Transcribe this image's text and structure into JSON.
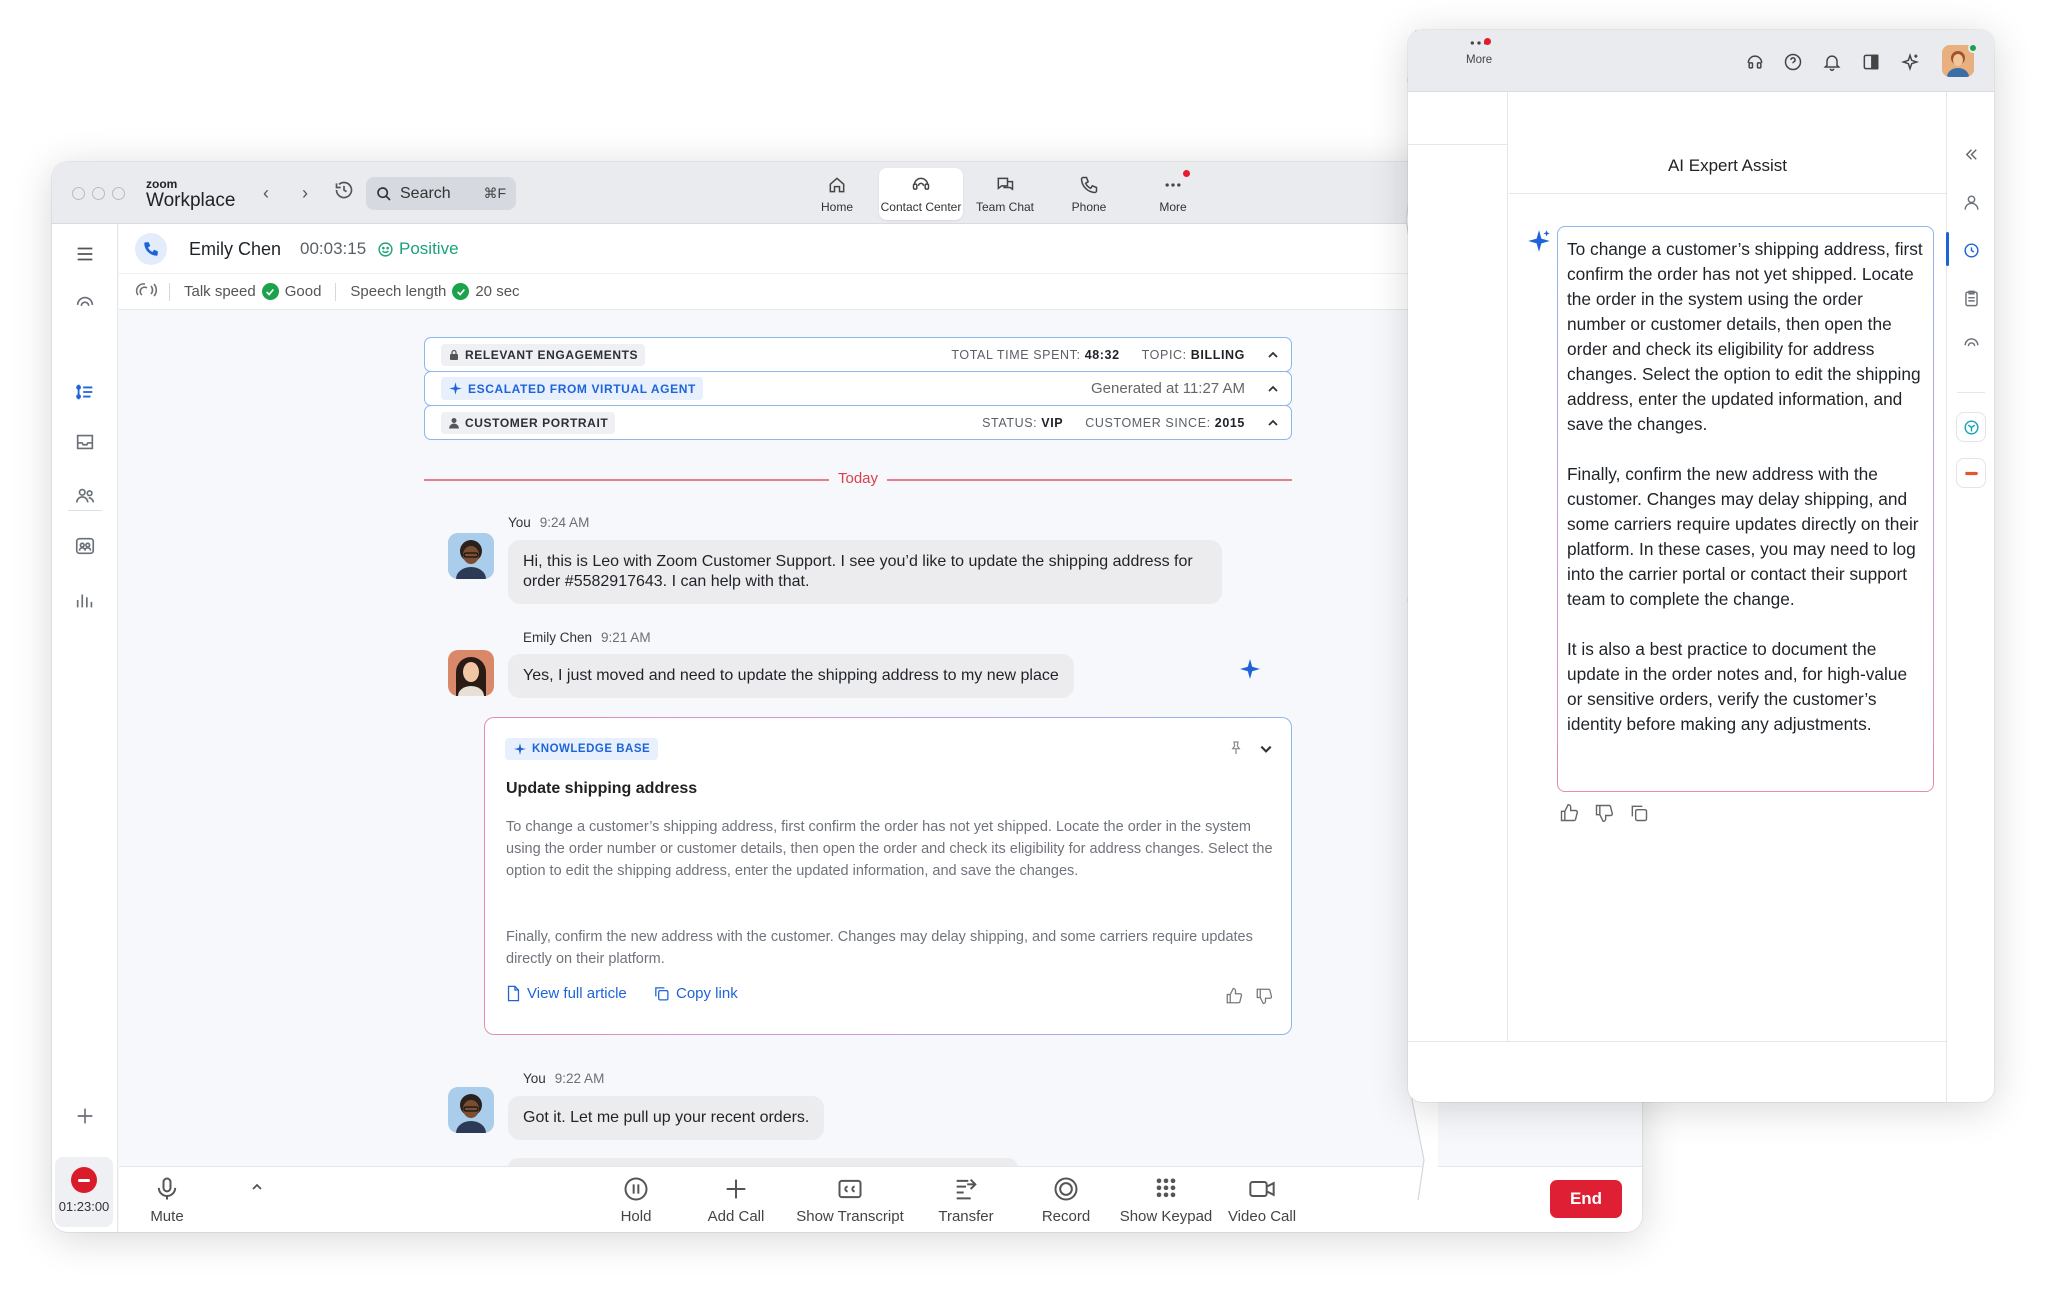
{
  "app": {
    "brand_small": "zoom",
    "brand_large": "Workplace"
  },
  "search": {
    "label": "Search",
    "shortcut": "⌘F"
  },
  "top_nav": [
    {
      "label": "Home",
      "icon": "home-icon"
    },
    {
      "label": "Contact Center",
      "icon": "contact-center-icon",
      "active": true
    },
    {
      "label": "Team Chat",
      "icon": "team-chat-icon"
    },
    {
      "label": "Phone",
      "icon": "phone-icon"
    },
    {
      "label": "More",
      "icon": "more-icon",
      "notification": true
    }
  ],
  "call": {
    "caller": "Emily Chen",
    "timer": "00:03:15",
    "sentiment": "Positive"
  },
  "metrics": {
    "talk_speed_label": "Talk speed",
    "talk_speed_value": "Good",
    "speech_length_label": "Speech length",
    "speech_length_value": "20 sec"
  },
  "engagements": {
    "relevant": {
      "label": "RELEVANT ENGAGEMENTS",
      "time_label": "TOTAL TIME SPENT:",
      "time_value": "48:32",
      "topic_label": "TOPIC:",
      "topic_value": "BILLING"
    },
    "escalated": {
      "label": "ESCALATED FROM VIRTUAL AGENT",
      "generated": "Generated at 11:27 AM"
    },
    "portrait": {
      "label": "CUSTOMER PORTRAIT",
      "status_label": "STATUS:",
      "status_value": "VIP",
      "since_label": "CUSTOMER SINCE:",
      "since_value": "2015"
    }
  },
  "divider": {
    "label": "Today"
  },
  "messages": [
    {
      "sender": "You",
      "time": "9:24 AM",
      "text": "Hi, this is Leo with Zoom Customer Support. I see you’d like to update the shipping address for order #5582917643. I can help with that."
    },
    {
      "sender": "Emily Chen",
      "time": "9:21 AM",
      "text": "Yes, I just moved and need to update the shipping address to my new place"
    },
    {
      "sender": "You",
      "time": "9:22 AM",
      "text": "Got it. Let me pull up your recent orders."
    }
  ],
  "knowledge_base": {
    "tag": "KNOWLEDGE BASE",
    "title": "Update shipping address",
    "paragraph1": "To change a customer’s shipping address, first confirm the order has not yet shipped. Locate the order in the system using the order number or customer details, then open the order and check its eligibility for address changes. Select the option to edit the shipping address, enter the updated information, and save the changes.",
    "paragraph2": "Finally, confirm the new address with the customer. Changes may delay shipping, and some carriers require updates directly on their platform.",
    "view_link": "View full article",
    "copy_link": "Copy link"
  },
  "rail": {
    "timer": "01:23:00"
  },
  "toolbar": {
    "mute": "Mute",
    "hold": "Hold",
    "add_call": "Add Call",
    "transcript": "Show Transcript",
    "transfer": "Transfer",
    "record": "Record",
    "keypad": "Show Keypad",
    "video": "Video Call",
    "end": "End"
  },
  "assist": {
    "more_label": "More",
    "title": "AI Expert Assist",
    "paragraph1": "To change a customer’s shipping address, first confirm the order has not yet shipped. Locate the order in the system using the order number or customer details, then open the order and check its eligibility for address changes. Select the option to edit the shipping address, enter the updated information, and save the changes.",
    "paragraph2": "Finally, confirm the new address with the customer. Changes may delay shipping, and some carriers require updates directly on their platform. In these cases, you may need to log into the carrier portal or contact their support team to complete the change.",
    "paragraph3": "It is also a best practice to document the update in the order notes and, for high-value or sensitive orders, verify the customer’s identity before making any adjustments."
  },
  "colors": {
    "accent": "#1e64d8",
    "positive": "#1aa37a",
    "end": "#df1f33",
    "today": "#d9414f"
  }
}
